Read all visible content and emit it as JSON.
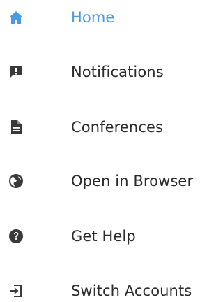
{
  "colors": {
    "active": "#4a9ae8",
    "icon": "#3a3a3a",
    "text": "#2b2b2b",
    "background": "#ffffff"
  },
  "menu": {
    "items": [
      {
        "label": "Home",
        "icon": "home-icon",
        "active": true
      },
      {
        "label": "Notifications",
        "icon": "notification-alert-icon",
        "active": false
      },
      {
        "label": "Conferences",
        "icon": "document-icon",
        "active": false
      },
      {
        "label": "Open in Browser",
        "icon": "globe-icon",
        "active": false
      },
      {
        "label": "Get Help",
        "icon": "help-icon",
        "active": false
      },
      {
        "label": "Switch Accounts",
        "icon": "switch-account-icon",
        "active": false
      }
    ]
  }
}
